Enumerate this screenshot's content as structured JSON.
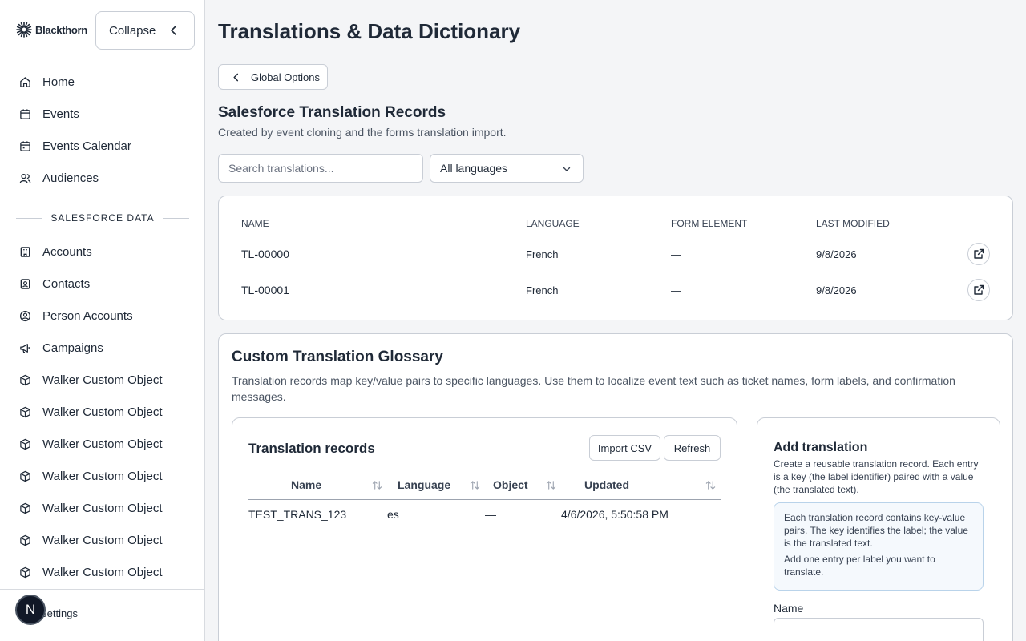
{
  "sidebar": {
    "logo_text": "Blackthorn",
    "collapse_label": "Collapse",
    "nav_items": [
      {
        "label": "Home",
        "icon": "home-icon"
      },
      {
        "label": "Events",
        "icon": "calendar-icon"
      },
      {
        "label": "Events Calendar",
        "icon": "calendar-icon"
      },
      {
        "label": "Audiences",
        "icon": "users-icon"
      }
    ],
    "section_label": "SALESFORCE DATA",
    "data_items": [
      {
        "label": "Accounts",
        "icon": "building-icon"
      },
      {
        "label": "Contacts",
        "icon": "contact-card-icon"
      },
      {
        "label": "Person Accounts",
        "icon": "person-circle-icon"
      },
      {
        "label": "Campaigns",
        "icon": "megaphone-icon"
      },
      {
        "label": "Walker Custom Object",
        "icon": "cube-icon"
      },
      {
        "label": "Walker Custom Object",
        "icon": "cube-icon"
      },
      {
        "label": "Walker Custom Object",
        "icon": "cube-icon"
      },
      {
        "label": "Walker Custom Object",
        "icon": "cube-icon"
      },
      {
        "label": "Walker Custom Object",
        "icon": "cube-icon"
      },
      {
        "label": "Walker Custom Object",
        "icon": "cube-icon"
      },
      {
        "label": "Walker Custom Object",
        "icon": "cube-icon"
      }
    ],
    "settings_label": "Settings",
    "avatar_letter": "N"
  },
  "page": {
    "title": "Translations & Data Dictionary",
    "back_label": "Global Options"
  },
  "sf_records": {
    "title": "Salesforce Translation Records",
    "subtitle": "Created by event cloning and the forms translation import.",
    "search_placeholder": "Search translations...",
    "language_filter": "All languages",
    "columns": [
      "NAME",
      "LANGUAGE",
      "FORM ELEMENT",
      "LAST MODIFIED"
    ],
    "rows": [
      {
        "name": "TL-00000",
        "language": "French",
        "form_element": "—",
        "last_modified": "9/8/2026"
      },
      {
        "name": "TL-00001",
        "language": "French",
        "form_element": "—",
        "last_modified": "9/8/2026"
      }
    ]
  },
  "glossary": {
    "title": "Custom Translation Glossary",
    "description": "Translation records map key/value pairs to specific languages. Use them to localize event text such as ticket names, form labels, and confirmation messages.",
    "records": {
      "title": "Translation records",
      "import_label": "Import CSV",
      "refresh_label": "Refresh",
      "columns": [
        "Name",
        "Language",
        "Object",
        "Updated"
      ],
      "rows": [
        {
          "name": "TEST_TRANS_123",
          "language": "es",
          "object": "—",
          "updated": "4/6/2026, 5:50:58 PM"
        }
      ]
    },
    "add": {
      "title": "Add translation",
      "description": "Create a reusable translation record. Each entry is a key (the label identifier) paired with a value (the translated text).",
      "info_1": "Each translation record contains key-value pairs. The key identifies the label; the value is the translated text.",
      "info_2": "Add one entry per label you want to translate.",
      "name_label": "Name"
    }
  }
}
